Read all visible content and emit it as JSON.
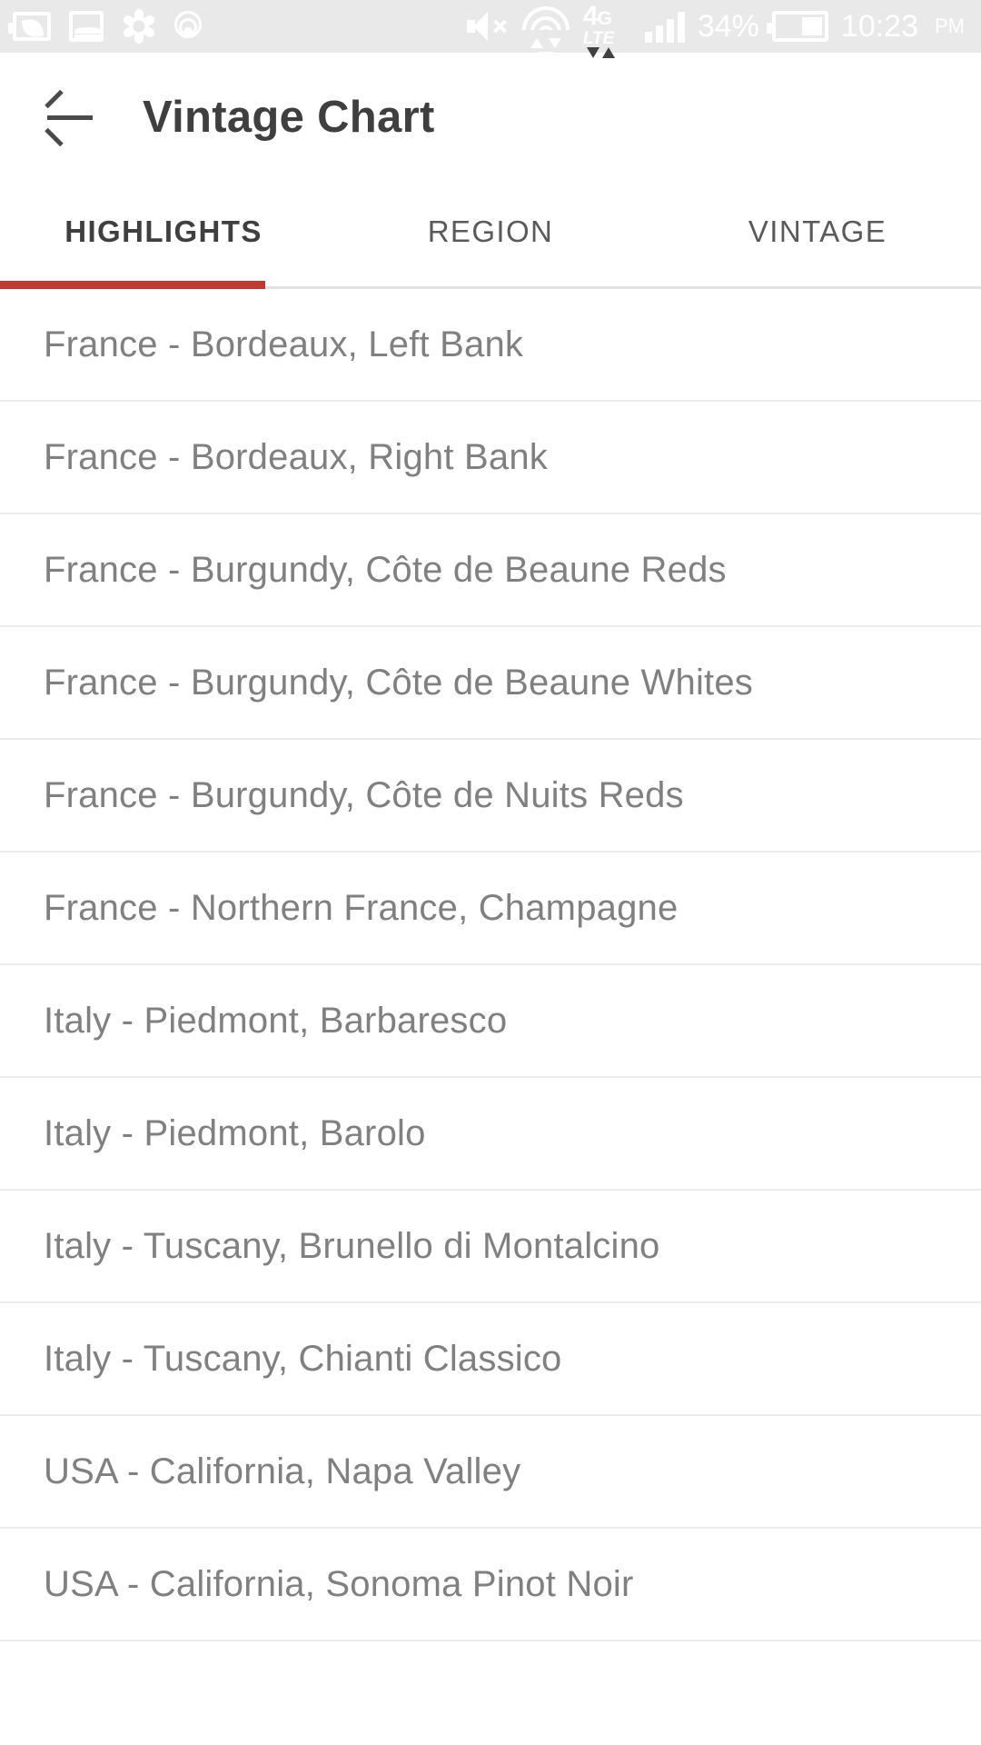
{
  "statusbar": {
    "icons_left": [
      "power-save-icon",
      "screenshot-icon",
      "puzzle-icon",
      "shield-icon"
    ],
    "icons_right": [
      "mute-icon",
      "wifi-icon",
      "4g-lte-icon",
      "signal-icon"
    ],
    "lte_primary": "4",
    "lte_primary_small": "G",
    "lte_secondary": "LTE",
    "battery_percent": "34%",
    "time": "10:23",
    "ampm": "PM"
  },
  "appbar": {
    "back_icon": "back-arrow-icon",
    "title": "Vintage Chart"
  },
  "tabs": {
    "items": [
      {
        "label": "HIGHLIGHTS",
        "active": true
      },
      {
        "label": "REGION",
        "active": false
      },
      {
        "label": "VINTAGE",
        "active": false
      }
    ],
    "indicator_color": "#c2392f",
    "base_color": "#e2e2e2"
  },
  "list": {
    "rows": [
      {
        "label": "France - Bordeaux, Left Bank"
      },
      {
        "label": "France - Bordeaux, Right Bank"
      },
      {
        "label": "France - Burgundy, Côte de Beaune Reds"
      },
      {
        "label": "France - Burgundy, Côte de Beaune Whites"
      },
      {
        "label": "France - Burgundy, Côte de Nuits Reds"
      },
      {
        "label": "France - Northern France, Champagne"
      },
      {
        "label": "Italy - Piedmont, Barbaresco"
      },
      {
        "label": "Italy - Piedmont, Barolo"
      },
      {
        "label": "Italy - Tuscany, Brunello di Montalcino"
      },
      {
        "label": "Italy - Tuscany, Chianti Classico"
      },
      {
        "label": "USA - California, Napa Valley"
      },
      {
        "label": "USA - California, Sonoma Pinot Noir"
      }
    ]
  },
  "colors": {
    "statusbar_bg": "#e9e9e9",
    "accent_red": "#c2392f",
    "title_text": "#3f3f3f",
    "row_text": "#808080",
    "divider": "#ececec"
  }
}
